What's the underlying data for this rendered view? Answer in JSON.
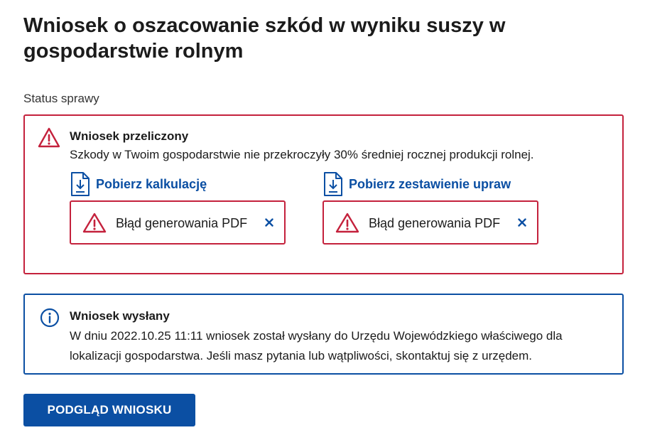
{
  "page": {
    "title": "Wniosek o oszacowanie szkód w wyniku suszy w gospodarstwie rolnym",
    "status_label": "Status sprawy"
  },
  "alert_error": {
    "icon": "warning-triangle-icon",
    "title": "Wniosek przeliczony",
    "description": "Szkody w Twoim gospodarstwie nie przekroczyły 30% średniej rocznej produkcji rolnej.",
    "links": [
      {
        "label": "Pobierz kalkulację",
        "icon": "file-download-icon"
      },
      {
        "label": "Pobierz zestawienie upraw",
        "icon": "file-download-icon"
      }
    ],
    "pdf_errors": [
      {
        "text": "Błąd generowania PDF",
        "icon": "warning-triangle-icon",
        "close_icon": "close-icon"
      },
      {
        "text": "Błąd generowania PDF",
        "icon": "warning-triangle-icon",
        "close_icon": "close-icon"
      }
    ]
  },
  "alert_info": {
    "icon": "info-circle-icon",
    "title": "Wniosek wysłany",
    "description": "W dniu 2022.10.25 11:11 wniosek został wysłany do Urzędu Wojewódzkiego właściwego dla lokalizacji gospodarstwa. Jeśli masz pytania lub wątpliwości, skontaktuj się z urzędem."
  },
  "actions": {
    "preview_button": "PODGLĄD WNIOSKU"
  },
  "colors": {
    "error": "#c4213c",
    "primary": "#0b4fa3",
    "text": "#1b1b1b"
  }
}
